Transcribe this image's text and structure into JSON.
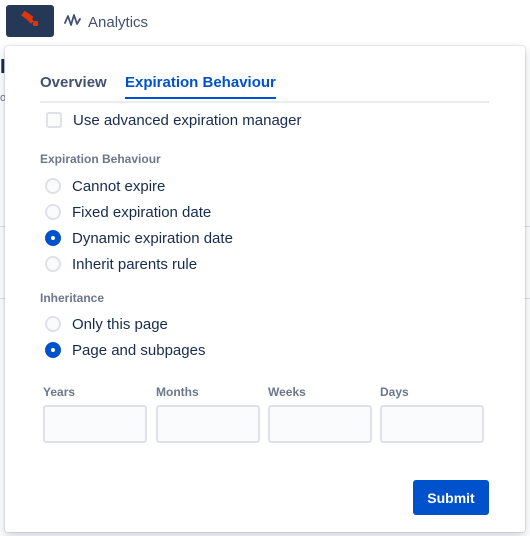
{
  "topbar": {
    "brand_icon": "telescope-icon",
    "analytics_label": "Analytics",
    "analytics_icon": "pulse-icon"
  },
  "background": {
    "heading_fragment": "I",
    "text_fragment": "o"
  },
  "dialog": {
    "tabs": [
      {
        "label": "Overview",
        "active": false
      },
      {
        "label": "Expiration Behaviour",
        "active": true
      }
    ],
    "advanced_manager": {
      "label": "Use advanced expiration manager",
      "checked": false
    },
    "expiration": {
      "section_label": "Expiration Behaviour",
      "options": [
        {
          "label": "Cannot expire",
          "checked": false
        },
        {
          "label": "Fixed expiration date",
          "checked": false
        },
        {
          "label": "Dynamic expiration date",
          "checked": true
        },
        {
          "label": "Inherit parents rule",
          "checked": false
        }
      ]
    },
    "inheritance": {
      "section_label": "Inheritance",
      "options": [
        {
          "label": "Only this page",
          "checked": false
        },
        {
          "label": "Page and subpages",
          "checked": true
        }
      ]
    },
    "duration_fields": [
      {
        "label": "Years",
        "value": ""
      },
      {
        "label": "Months",
        "value": ""
      },
      {
        "label": "Weeks",
        "value": ""
      },
      {
        "label": "Days",
        "value": ""
      }
    ],
    "submit_label": "Submit"
  },
  "colors": {
    "accent": "#0052CC",
    "brand_bg": "#253858",
    "brand_icon": "#DE350B"
  }
}
